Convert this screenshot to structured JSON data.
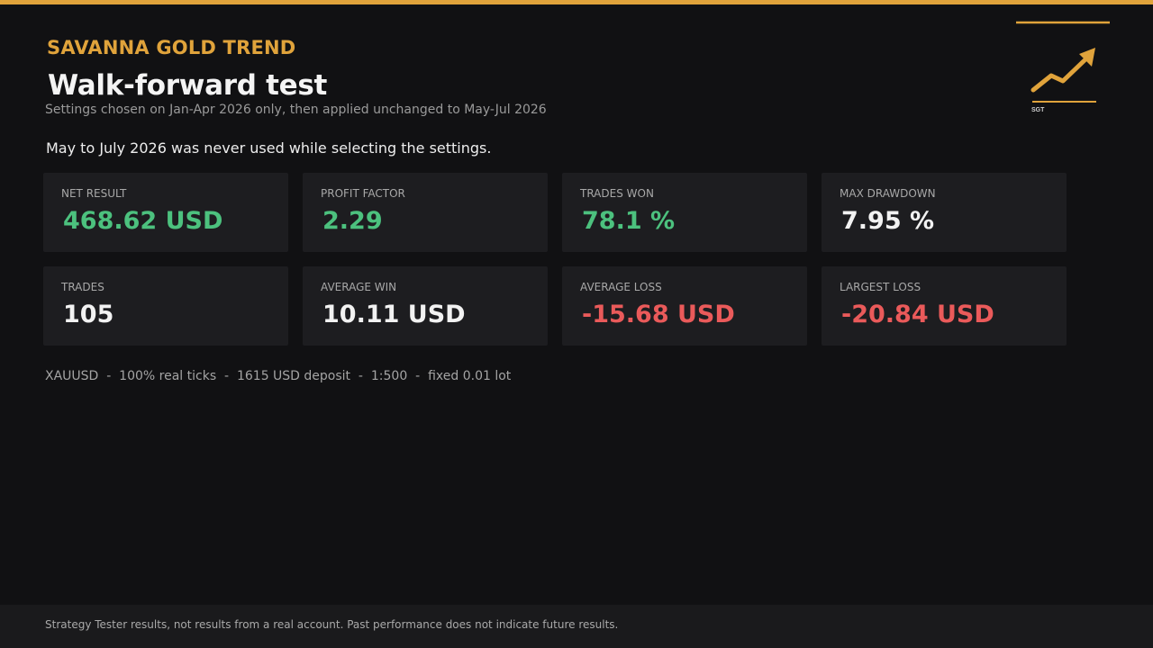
{
  "colors": {
    "accent": "#e0a33b",
    "background": "#111113",
    "card": "#1d1d20",
    "positive": "#4cc17e",
    "negative": "#ea5a5a",
    "neutral": "#f2f2f2"
  },
  "header": {
    "brand": "SAVANNA GOLD TREND",
    "title": "Walk-forward test",
    "subtitle": "Settings chosen on Jan-Apr 2026 only, then applied unchanged to May-Jul 2026",
    "note": "May to July 2026 was never used while selecting the settings."
  },
  "logo": {
    "icon": "trend-up-arrow-icon",
    "text": "SGT"
  },
  "metrics": [
    {
      "label": "NET RESULT",
      "value": "468.62 USD",
      "tone": "positive"
    },
    {
      "label": "PROFIT FACTOR",
      "value": "2.29",
      "tone": "positive"
    },
    {
      "label": "TRADES WON",
      "value": "78.1 %",
      "tone": "positive"
    },
    {
      "label": "MAX DRAWDOWN",
      "value": "7.95 %",
      "tone": "neutral"
    },
    {
      "label": "TRADES",
      "value": "105",
      "tone": "neutral"
    },
    {
      "label": "AVERAGE WIN",
      "value": "10.11 USD",
      "tone": "neutral"
    },
    {
      "label": "AVERAGE LOSS",
      "value": "-15.68 USD",
      "tone": "negative"
    },
    {
      "label": "LARGEST LOSS",
      "value": "-20.84 USD",
      "tone": "negative"
    }
  ],
  "footnote": "XAUUSD  -  100% real ticks  -  1615 USD deposit  -  1:500  -  fixed 0.01 lot",
  "disclaimer": "Strategy Tester results, not results from a real account. Past performance does not indicate future results."
}
